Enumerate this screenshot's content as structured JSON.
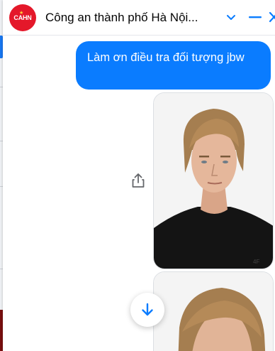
{
  "chat": {
    "avatar_text": "CAHN",
    "title": "Công an thành phố Hà Nội...",
    "icons": {
      "collapse": "chevron-down-icon",
      "minimize": "minimize-icon",
      "close": "close-icon",
      "share": "share-icon",
      "scroll_down": "arrow-down-icon"
    }
  },
  "messages": [
    {
      "type": "text",
      "sender": "me",
      "text": "Làm ơn điều tra đối tượng jbw"
    },
    {
      "type": "image",
      "sender": "me",
      "alt": "portrait photo"
    },
    {
      "type": "image",
      "sender": "me",
      "alt": "portrait photo"
    }
  ],
  "colors": {
    "accent": "#0a7cff",
    "avatar_bg": "#e4182a",
    "bubble_text": "#ffffff"
  }
}
